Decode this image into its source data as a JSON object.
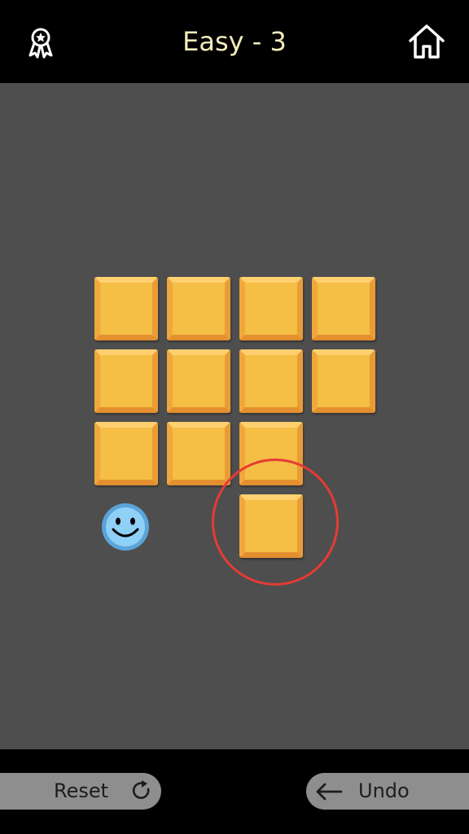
{
  "header": {
    "title": "Easy - 3",
    "left_icon": "award-ribbon-icon",
    "right_icon": "home-icon"
  },
  "board": {
    "tile_color": "#f5be45",
    "background_color": "#4e4e4e",
    "tiles": [
      {
        "row": 0,
        "col": 0
      },
      {
        "row": 0,
        "col": 1
      },
      {
        "row": 0,
        "col": 2
      },
      {
        "row": 0,
        "col": 3
      },
      {
        "row": 1,
        "col": 0
      },
      {
        "row": 1,
        "col": 1
      },
      {
        "row": 1,
        "col": 2
      },
      {
        "row": 1,
        "col": 3
      },
      {
        "row": 2,
        "col": 0
      },
      {
        "row": 2,
        "col": 1
      },
      {
        "row": 2,
        "col": 2
      },
      {
        "row": 3,
        "col": 2
      }
    ],
    "player": {
      "row": 3,
      "col": 0,
      "icon": "smiley-face-icon",
      "color": "#7ec6f2"
    },
    "highlight": {
      "row": 3,
      "col": 2,
      "color": "#e53b35"
    }
  },
  "footer": {
    "reset_label": "Reset",
    "reset_icon": "refresh-icon",
    "undo_label": "Undo",
    "undo_icon": "arrow-left-icon",
    "button_color": "#8e8e8e"
  }
}
